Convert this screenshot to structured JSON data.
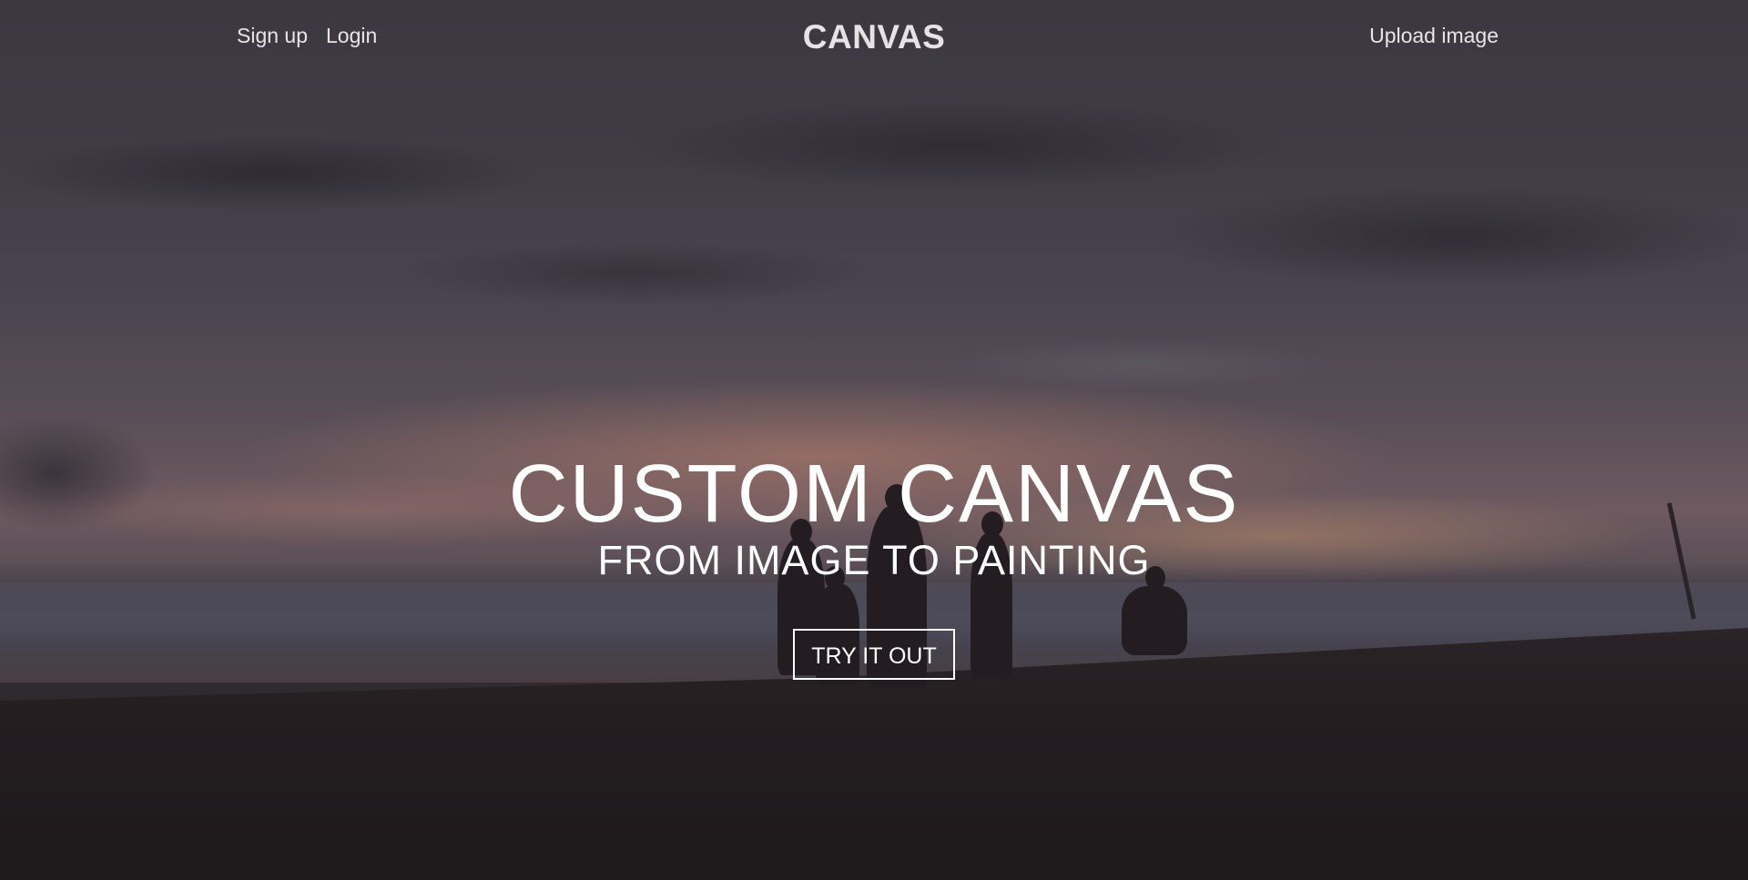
{
  "header": {
    "nav_left": [
      {
        "label": "Sign up"
      },
      {
        "label": "Login"
      }
    ],
    "logo": "CANVAS",
    "upload_label": "Upload image"
  },
  "hero": {
    "title": "CUSTOM CANVAS",
    "subtitle": "FROM IMAGE TO PAINTING",
    "cta_label": "TRY IT OUT"
  },
  "colors": {
    "text": "#ffffff",
    "nav_text": "#e8e4e8",
    "overlay_dark": "#1f1a1c"
  }
}
